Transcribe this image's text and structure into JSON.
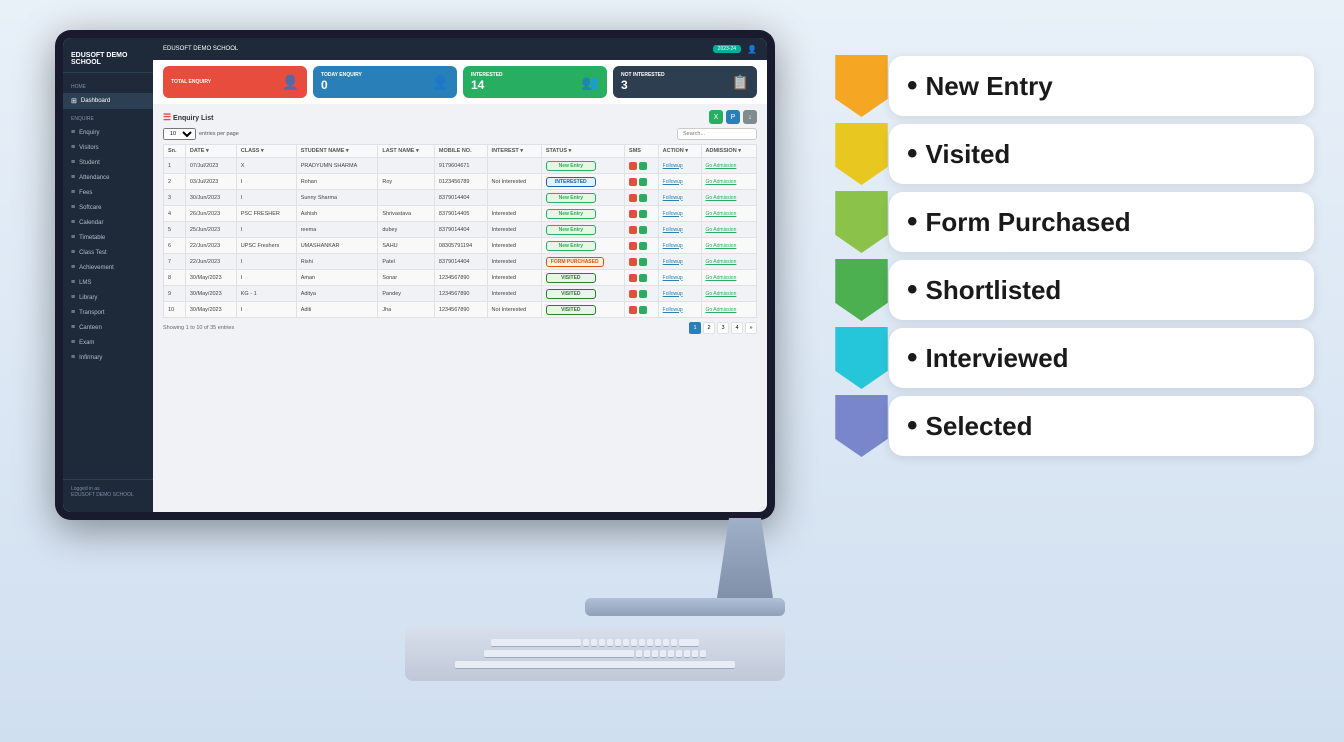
{
  "app": {
    "title": "EDUSOFT DEMO SCHOOL",
    "year_badge": "2023-24"
  },
  "stats": [
    {
      "label": "TOTAL ENQUIRY",
      "value": "",
      "icon": "👤",
      "color": "red"
    },
    {
      "label": "TODAY ENQUIRY",
      "value": "0",
      "icon": "👤",
      "color": "blue"
    },
    {
      "label": "INTERESTED",
      "value": "14",
      "icon": "👥",
      "color": "green"
    },
    {
      "label": "NOT INTERESTED",
      "value": "3",
      "icon": "📋",
      "color": "dark"
    }
  ],
  "sidebar": {
    "items": [
      {
        "label": "Dashboard",
        "icon": "⊞"
      },
      {
        "label": "Enquiry",
        "icon": "≡"
      },
      {
        "label": "Visitors",
        "icon": "≡"
      },
      {
        "label": "Student",
        "icon": "≡"
      },
      {
        "label": "Attendance",
        "icon": "≡"
      },
      {
        "label": "Fees",
        "icon": "≡"
      },
      {
        "label": "Softcare",
        "icon": "≡"
      },
      {
        "label": "Calendar",
        "icon": "≡"
      },
      {
        "label": "Timetable",
        "icon": "≡"
      },
      {
        "label": "Class Test",
        "icon": "≡"
      },
      {
        "label": "Achievement",
        "icon": "≡"
      },
      {
        "label": "LMS",
        "icon": "≡"
      },
      {
        "label": "Library",
        "icon": "≡"
      },
      {
        "label": "Transport",
        "icon": "≡"
      },
      {
        "label": "Canteen",
        "icon": "≡"
      },
      {
        "label": "Exam",
        "icon": "≡"
      },
      {
        "label": "Infirmary",
        "icon": "≡"
      }
    ]
  },
  "table": {
    "title": "Enquiry List",
    "show_entries_label": "entries per page",
    "search_placeholder": "Search...",
    "showing_info": "Showing 1 to 10 of 35 entries",
    "columns": [
      "Sn.",
      "DATE",
      "CLASS",
      "STUDENT NAME",
      "LAST NAME",
      "MOBILE NO.",
      "INTEREST",
      "STATUS",
      "SMS",
      "ACTION",
      "ADMISSION"
    ],
    "rows": [
      {
        "sn": "1",
        "date": "07/Jul/2023",
        "class": "X",
        "student": "PRADYUMN SHARMA",
        "last": "",
        "mobile": "9179604671",
        "interest": "",
        "status": "New Entry",
        "status_type": "new"
      },
      {
        "sn": "2",
        "date": "03/Jul/2023",
        "class": "I",
        "student": "Rohan",
        "last": "Roy",
        "mobile": "0123456789",
        "interest": "Not Interested",
        "status": "INTERESTED",
        "status_type": "interested"
      },
      {
        "sn": "3",
        "date": "30/Jun/2023",
        "class": "I",
        "student": "Sunny Sharma",
        "last": "",
        "mobile": "8379014404",
        "interest": "",
        "status": "New Entry",
        "status_type": "new"
      },
      {
        "sn": "4",
        "date": "26/Jun/2023",
        "class": "PSC FRESHER",
        "student": "Ashish",
        "last": "Shrivastava",
        "mobile": "8379014405",
        "interest": "Interested",
        "status": "New Entry",
        "status_type": "new"
      },
      {
        "sn": "5",
        "date": "25/Jun/2023",
        "class": "I",
        "student": "reema",
        "last": "dubey",
        "mobile": "8379014404",
        "interest": "Interested",
        "status": "New Entry",
        "status_type": "new"
      },
      {
        "sn": "6",
        "date": "22/Jun/2023",
        "class": "UPSC Freshers",
        "student": "UMASHANKAR",
        "last": "SAHU",
        "mobile": "08305791194",
        "interest": "Interested",
        "status": "New Entry",
        "status_type": "new"
      },
      {
        "sn": "7",
        "date": "22/Jun/2023",
        "class": "I",
        "student": "Rishi",
        "last": "Patel",
        "mobile": "8379014404",
        "interest": "Interested",
        "status": "FORM PURCHASED",
        "status_type": "purchased"
      },
      {
        "sn": "8",
        "date": "30/May/2023",
        "class": "I",
        "student": "Aman",
        "last": "Sonar",
        "mobile": "1234567890",
        "interest": "Interested",
        "status": "VISITED",
        "status_type": "visited"
      },
      {
        "sn": "9",
        "date": "30/May/2023",
        "class": "KG - 1",
        "student": "Aditya",
        "last": "Pandey",
        "mobile": "1234567890",
        "interest": "Interested",
        "status": "VISITED",
        "status_type": "visited"
      },
      {
        "sn": "10",
        "date": "30/May/2023",
        "class": "I",
        "student": "Aditi",
        "last": "Jha",
        "mobile": "1234567890",
        "interest": "Not Interested",
        "status": "VISITED",
        "status_type": "visited"
      }
    ],
    "pages": [
      "1",
      "2",
      "3",
      "4",
      "»"
    ]
  },
  "workflow": {
    "steps": [
      {
        "label": "New Entry",
        "arrow_color": "#f5a623"
      },
      {
        "label": "Visited",
        "arrow_color": "#e8c820"
      },
      {
        "label": "Form Purchased",
        "arrow_color": "#8bc34a"
      },
      {
        "label": "Shortlisted",
        "arrow_color": "#4caf50"
      },
      {
        "label": "Interviewed",
        "arrow_color": "#26c6da"
      },
      {
        "label": "Selected",
        "arrow_color": "#7986cb"
      }
    ]
  }
}
